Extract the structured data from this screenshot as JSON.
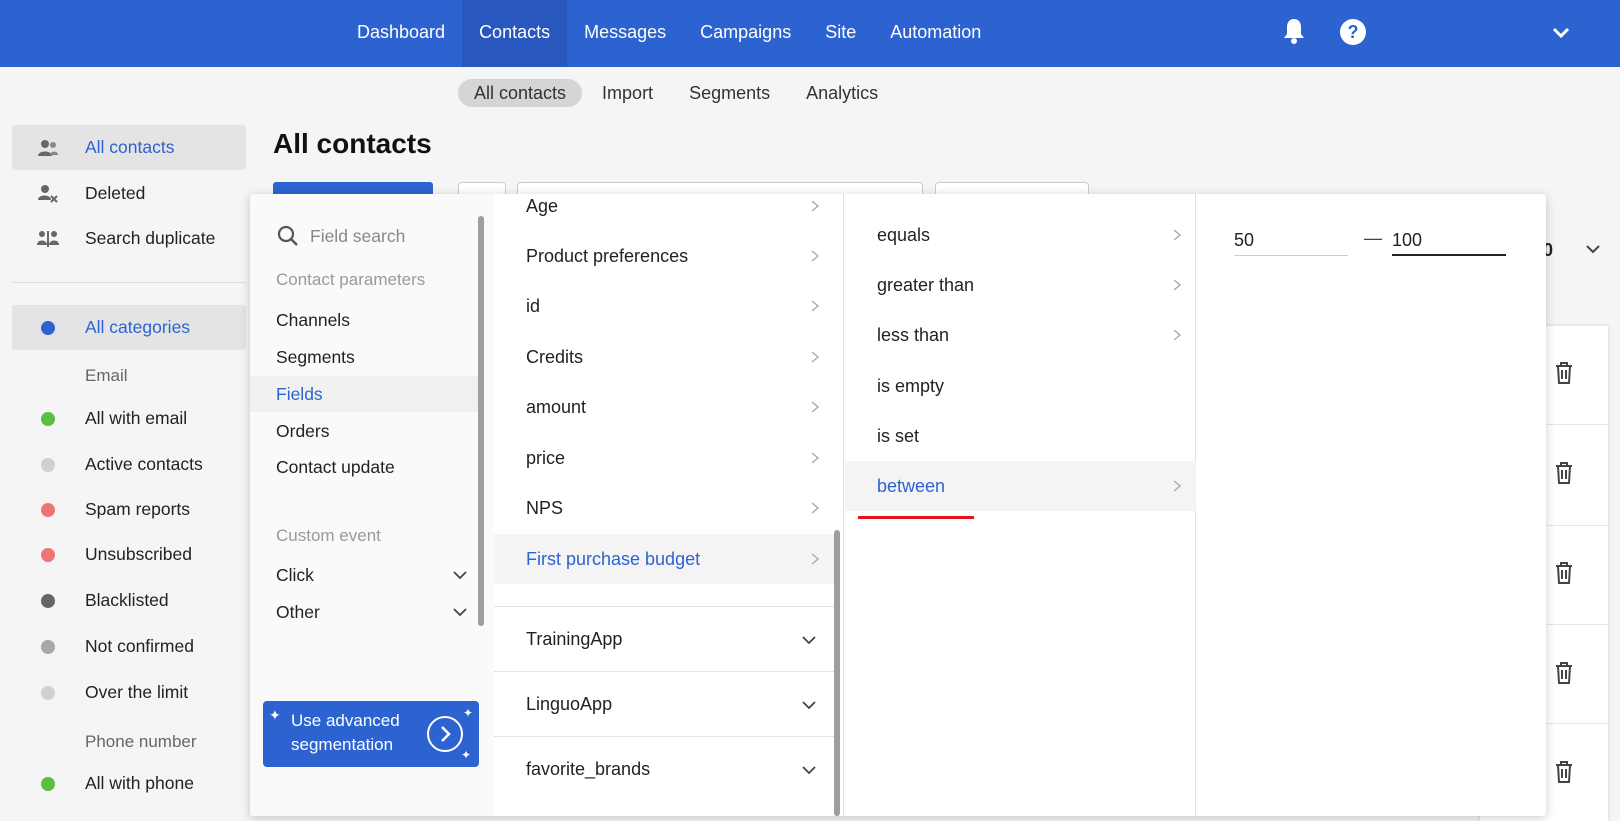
{
  "top_nav": {
    "items": [
      "Dashboard",
      "Contacts",
      "Messages",
      "Campaigns",
      "Site",
      "Automation"
    ],
    "active": "Contacts",
    "help_glyph": "?"
  },
  "sub_nav": {
    "items": [
      "All contacts",
      "Import",
      "Segments",
      "Analytics"
    ],
    "active": "All contacts"
  },
  "sidebar": {
    "top_items": [
      {
        "label": "All contacts",
        "icon": "contacts-icon"
      },
      {
        "label": "Deleted",
        "icon": "user-remove-icon"
      },
      {
        "label": "Search duplicate",
        "icon": "duplicate-icon"
      }
    ],
    "all_categories": "All categories",
    "email_heading": "Email",
    "email_items": [
      {
        "label": "All with email",
        "color": "#5cbd45"
      },
      {
        "label": "Active contacts",
        "color": "#d0d0d0"
      },
      {
        "label": "Spam reports",
        "color": "#ef7474"
      },
      {
        "label": "Unsubscribed",
        "color": "#ef7474"
      },
      {
        "label": "Blacklisted",
        "color": "#666666"
      },
      {
        "label": "Not confirmed",
        "color": "#a8a8a8"
      },
      {
        "label": "Over the limit",
        "color": "#d0d0d0"
      }
    ],
    "phone_heading": "Phone number",
    "phone_items": [
      {
        "label": "All with phone",
        "color": "#5cbd45"
      }
    ],
    "category_color": "#2d63d1"
  },
  "page_title": "All contacts",
  "background": {
    "count_suffix": "0"
  },
  "filter_panel": {
    "search_placeholder": "Field search",
    "contact_params_heading": "Contact parameters",
    "contact_params": [
      "Channels",
      "Segments",
      "Fields",
      "Orders",
      "Contact update"
    ],
    "active_param": "Fields",
    "custom_event_heading": "Custom event",
    "custom_events": [
      "Click",
      "Other"
    ],
    "advanced_button": {
      "line1": "Use advanced",
      "line2": "segmentation"
    },
    "fields": [
      "Age",
      "Product preferences",
      "id",
      "Credits",
      "amount",
      "price",
      "NPS",
      "First purchase budget"
    ],
    "active_field": "First purchase budget",
    "field_groups": [
      "TrainingApp",
      "LinguoApp",
      "favorite_brands"
    ],
    "operators": [
      "equals",
      "greater than",
      "less than",
      "is empty",
      "is set",
      "between"
    ],
    "active_operator": "between",
    "range": {
      "from": "50",
      "separator": "—",
      "to": "100"
    }
  },
  "colors": {
    "brand": "#2d63d1",
    "highlight_underline": "#e2141a"
  }
}
